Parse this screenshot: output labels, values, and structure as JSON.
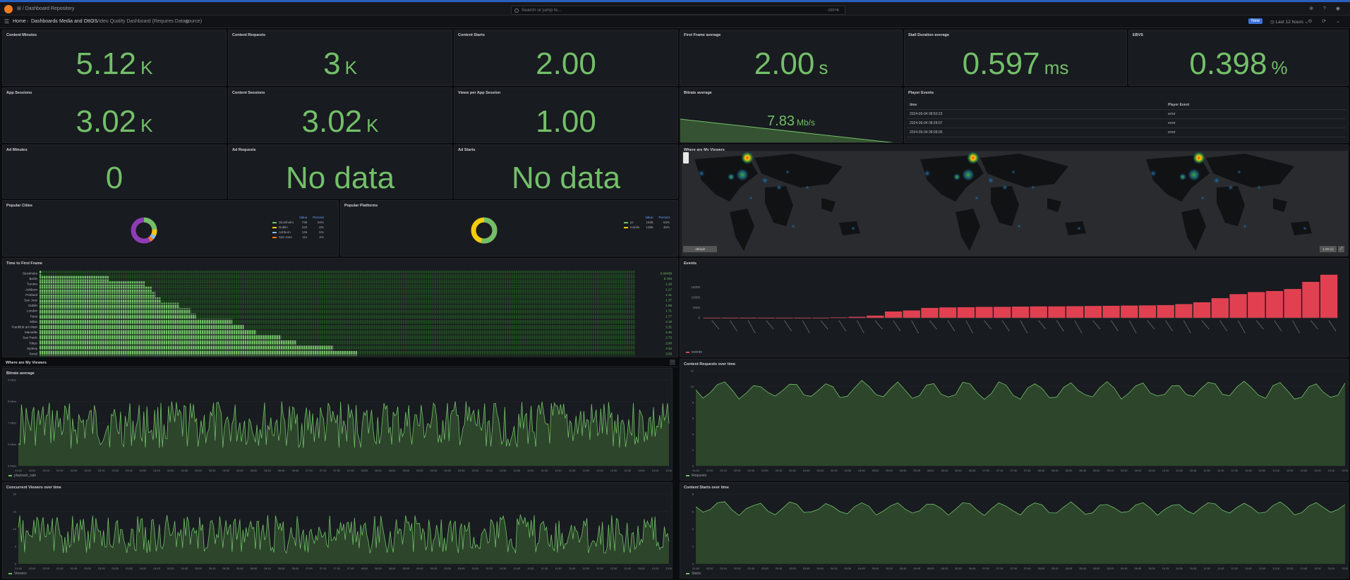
{
  "topbar": {
    "breadcrumb_root": "⊞ / Dashboard Repository",
    "search_placeholder": "Search or jump to...",
    "search_shortcut": "ctrl+k"
  },
  "subbar": {
    "crumbs": [
      "Home",
      "Dashboards",
      "Media and OttOS",
      "Video Quality Dashboard (Requires Datasource)"
    ],
    "badge": "New",
    "time_range": "Last 12 hours"
  },
  "stats": [
    {
      "title": "Content Minutes",
      "value": "5.12",
      "unit": "K"
    },
    {
      "title": "Content Requests",
      "value": "3",
      "unit": "K"
    },
    {
      "title": "Content Starts",
      "value": "2.00",
      "unit": ""
    },
    {
      "title": "First Frame average",
      "value": "2.00",
      "unit": "s"
    },
    {
      "title": "Stall Duration average",
      "value": "0.597",
      "unit": "ms"
    },
    {
      "title": "EBVS",
      "value": "0.398",
      "unit": "%"
    },
    {
      "title": "App Sessions",
      "value": "3.02",
      "unit": "K"
    },
    {
      "title": "Content Sessions",
      "value": "3.02",
      "unit": "K"
    },
    {
      "title": "Views per App Session",
      "value": "1.00",
      "unit": ""
    },
    {
      "title": "Ad Minutes",
      "value": "0",
      "unit": ""
    },
    {
      "title": "Ad Requests",
      "value": "No data",
      "unit": ""
    },
    {
      "title": "Ad Starts",
      "value": "No data",
      "unit": ""
    }
  ],
  "bitrate_stat": {
    "title": "Bitrate average",
    "value": "7.83",
    "unit": "Mb/s"
  },
  "player_events": {
    "title": "Player Events",
    "columns": [
      "time",
      "Player Event"
    ],
    "rows": [
      [
        "2024-06-04 08:50:23",
        "error"
      ],
      [
        "2024-06-04 08:28:07",
        "error"
      ],
      [
        "2024-06-04 08:08:05",
        "error"
      ]
    ]
  },
  "popular_cities": {
    "title": "Popular Cities",
    "headers": [
      "Value",
      "Percent"
    ],
    "rows": [
      {
        "name": "Stockholm",
        "value": "736",
        "percent": "24%",
        "color": "#73bf69"
      },
      {
        "name": "Dublin",
        "value": "220",
        "percent": "8%",
        "color": "#f2cc0c"
      },
      {
        "name": "Ashburn",
        "value": "136",
        "percent": "5%",
        "color": "#8ab8ff"
      },
      {
        "name": "San Jose",
        "value": "111",
        "percent": "4%",
        "color": "#ff780a"
      }
    ]
  },
  "popular_platforms": {
    "title": "Popular Platforms",
    "headers": [
      "Value",
      "Percent"
    ],
    "rows": [
      {
        "name": "pc",
        "value": "1636",
        "percent": "54%",
        "color": "#73bf69"
      },
      {
        "name": "mobile",
        "value": "1386",
        "percent": "46%",
        "color": "#f2cc0c"
      }
    ]
  },
  "map": {
    "title": "Where are My Viewers",
    "left_button": "default",
    "right_button": "1.00 (1)"
  },
  "ttff": {
    "title": "Time to First Frame",
    "cities": [
      "Stockholm",
      "Berlin",
      "Toronto",
      "Ashburn",
      "Portland",
      "San Jose",
      "Dublin",
      "London",
      "Paris",
      "Milan",
      "Frankfurt am Main",
      "Marseille",
      "San Paulo",
      "Tokyo",
      "Sydney",
      "Seoul"
    ],
    "values": [
      "0.00438",
      "0.783",
      "1.19",
      "1.27",
      "1.31",
      "1.37",
      "1.58",
      "1.71",
      "1.77",
      "2.18",
      "2.31",
      "2.45",
      "2.73",
      "2.90",
      "3.32",
      "3.59"
    ]
  },
  "events": {
    "title": "Events",
    "legend": "events",
    "y_ticks": [
      "15000",
      "10000",
      "5000",
      "0"
    ]
  },
  "section": {
    "title": "Where are My Viewers"
  },
  "bitrate_ts": {
    "title": "Bitrate average",
    "legend": "playback_rate",
    "y_ticks": [
      "9 Mb/s",
      "8 Mb/s",
      "7 Mb/s",
      "6 Mb/s",
      "5 Mb/s"
    ]
  },
  "requests_ts": {
    "title": "Content Requests over time",
    "legend": "Requests",
    "y_ticks": [
      "12",
      "10",
      "8",
      "6",
      "4",
      "2",
      "0"
    ]
  },
  "viewers_ts": {
    "title": "Concurrent Viewers over time",
    "legend": "Viewers",
    "y_ticks": [
      "20",
      "15",
      "10",
      "5",
      "0"
    ]
  },
  "starts_ts": {
    "title": "Content Starts over time",
    "legend": "Starts",
    "y_ticks": [
      "8",
      "6",
      "4",
      "2",
      "0"
    ]
  },
  "time_ticks": [
    "01:45",
    "02:00",
    "02:15",
    "02:30",
    "02:45",
    "03:00",
    "03:15",
    "03:30",
    "03:45",
    "04:00",
    "04:15",
    "04:30",
    "04:45",
    "05:00",
    "05:15",
    "05:30",
    "05:45",
    "06:00",
    "06:15",
    "06:30",
    "06:45",
    "07:00",
    "07:15",
    "07:30",
    "07:45",
    "08:00",
    "08:15",
    "08:30",
    "08:45",
    "09:00",
    "09:15",
    "09:30",
    "09:45",
    "10:00",
    "10:15",
    "10:30",
    "10:45",
    "11:00",
    "11:15",
    "11:30",
    "11:45",
    "12:00",
    "12:15",
    "12:30",
    "12:45",
    "13:00",
    "13:15",
    "13:30"
  ],
  "colors": {
    "green": "#73bf69",
    "red": "#e0404f",
    "accent": "#3d71d9"
  }
}
